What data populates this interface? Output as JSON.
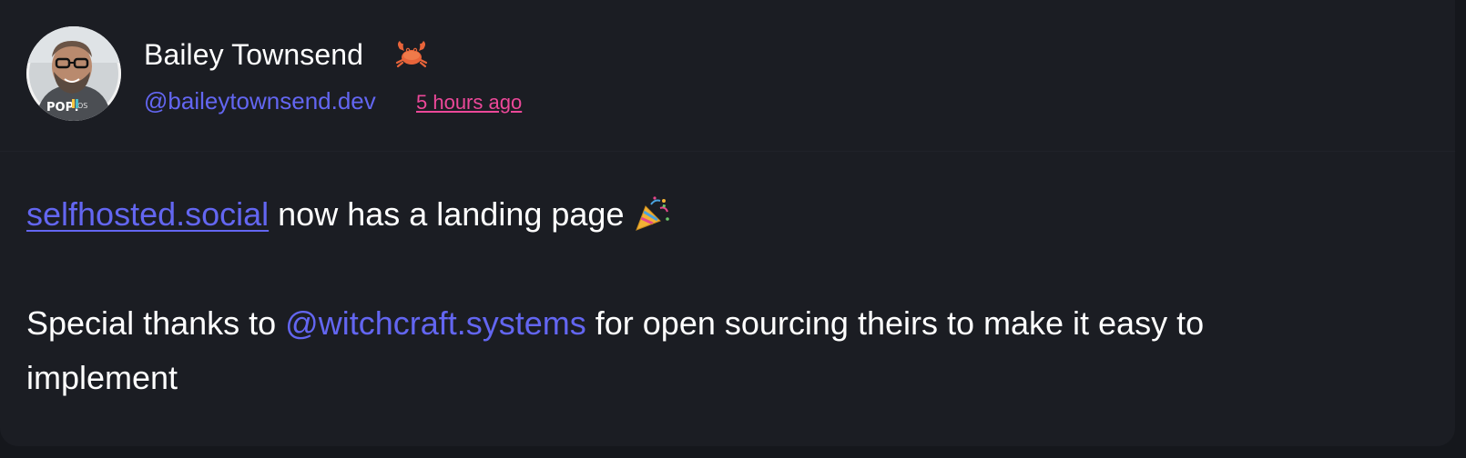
{
  "post": {
    "author": {
      "display_name": "Bailey Townsend",
      "name_emoji": "crab-icon",
      "handle": "@baileytownsend.dev",
      "avatar": "avatar"
    },
    "timestamp": "5 hours ago",
    "content": {
      "line1": {
        "link": "selfhosted.social",
        "text": " now has a landing page",
        "emoji": "party-popper-icon"
      },
      "line2": {
        "prefix": "Special thanks to ",
        "mention": "@witchcraft.systems",
        "suffix": " for open sourcing theirs to make it easy to"
      },
      "line3": {
        "text": "implement"
      }
    }
  },
  "colors": {
    "background": "#1b1d23",
    "page": "#15171c",
    "text": "#ffffff",
    "accent": "#6366f1",
    "timestamp": "#ec4899"
  }
}
